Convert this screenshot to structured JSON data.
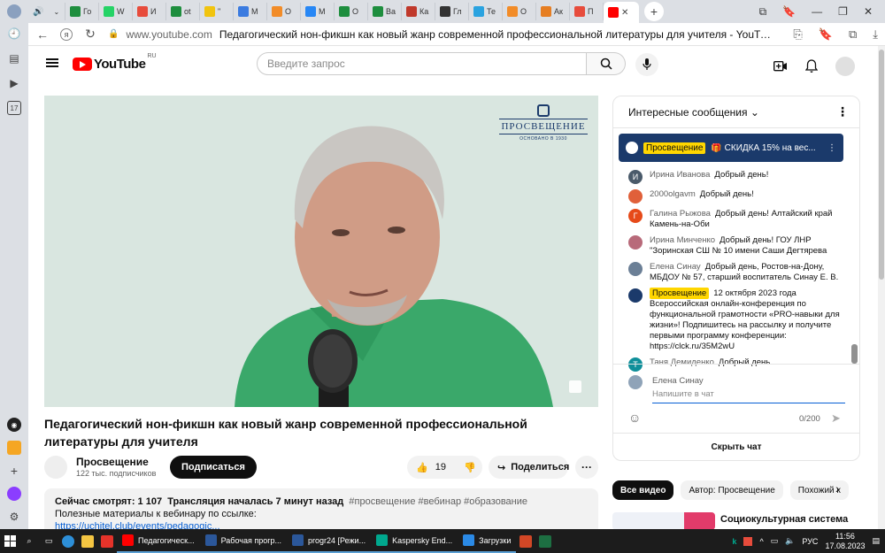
{
  "browser": {
    "tabs": [
      {
        "label": "Го",
        "color": "#1e8e3e"
      },
      {
        "label": "W",
        "color": "#25d366"
      },
      {
        "label": "И",
        "color": "#e74c3c"
      },
      {
        "label": "ot",
        "color": "#1e8e3e"
      },
      {
        "label": "\"",
        "color": "#f1c40f"
      },
      {
        "label": "М",
        "color": "#3b7be0"
      },
      {
        "label": "О",
        "color": "#f28c28"
      },
      {
        "label": "М",
        "color": "#2787f5"
      },
      {
        "label": "О",
        "color": "#1e8e3e"
      },
      {
        "label": "Ва",
        "color": "#1e8e3e"
      },
      {
        "label": "Ка",
        "color": "#c0392b"
      },
      {
        "label": "Гл",
        "color": "#333333"
      },
      {
        "label": "Те",
        "color": "#2aa3e0"
      },
      {
        "label": "О",
        "color": "#f28c28"
      },
      {
        "label": "Ак",
        "color": "#e67e22"
      },
      {
        "label": "П",
        "color": "#e74c3c"
      }
    ],
    "active_tab_color": "#ff0000",
    "new_tab_symbol": "+",
    "domain": "www.youtube.com",
    "page_title": "Педагогический нон-фикшн как новый жанр современной профессиональной литературы для учителя - YouTube",
    "rail_badge": "17"
  },
  "youtube": {
    "country": "RU",
    "logo_word": "YouTube",
    "search_placeholder": "Введите запрос",
    "brand": {
      "name": "ПРОСВЕЩЕНИЕ",
      "since": "ОСНОВАНО В 1930"
    },
    "video_title": "Педагогический нон-фикшн как новый жанр современной профессиональной литературы для учителя",
    "channel": {
      "name": "Просвещение",
      "subscribers": "122 тыс. подписчиков"
    },
    "subscribe_label": "Подписаться",
    "likes": "19",
    "share_label": "Поделиться",
    "description": {
      "watching": "Сейчас смотрят: 1 107",
      "started": "Трансляция началась 7 минут назад",
      "tags": "#просвещение #вебинар #образование",
      "line2": "Полезные материалы к вебинару по ссылке:",
      "link": "https://uchitel.club/events/pedagogic..."
    },
    "chat": {
      "header": "Интересные сообщения",
      "pinned": {
        "author": "Просвещение",
        "text": "🎁 СКИДКА 15% на вес..."
      },
      "messages": [
        {
          "author": "Ирина Иванова",
          "text": "Добрый день!",
          "avatar_letter": "И",
          "avatar_color": "#4a5a6a",
          "owner": false
        },
        {
          "author": "2000olgavm",
          "text": "Добрый день!",
          "avatar_letter": "",
          "avatar_color": "#e0603a",
          "owner": false
        },
        {
          "author": "Галина Рыжова",
          "text": "Добрый день! Алтайский край Камень-на-Оби",
          "avatar_letter": "Г",
          "avatar_color": "#e64a19",
          "owner": false
        },
        {
          "author": "Ирина Минченко",
          "text": "Добрый день! ГОУ ЛНР \"Зоринская СШ № 10 имени Саши Дегтярева",
          "avatar_letter": "",
          "avatar_color": "#b86a7a",
          "owner": false
        },
        {
          "author": "Елена Синау",
          "text": "Добрый день, Ростов-на-Дону, МБДОУ № 57, старший воспитатель Синау Е. В.",
          "avatar_letter": "",
          "avatar_color": "#6b7f96",
          "owner": false
        },
        {
          "author": "Просвещение",
          "text": "12 октября 2023 года Всероссийская онлайн-конференция по функциональной грамотности «PRO-навыки для жизни»! Подпишитесь на рассылку и получите первыми программу конференции: https://clck.ru/35M2wU",
          "avatar_letter": "",
          "avatar_color": "#1b3a6b",
          "owner": true
        },
        {
          "author": "Таня Демиденко",
          "text": "Добрый день.",
          "avatar_letter": "Т",
          "avatar_color": "#0f8f9a",
          "owner": false
        }
      ],
      "input_user": "Елена Синау",
      "input_placeholder": "Напишите в чат",
      "char_count": "0/200",
      "hide_label": "Скрыть чат"
    },
    "chips": [
      "Все видео",
      "Автор: Просвещение",
      "Похожий к"
    ],
    "recommendation_title": "Социокультурная система"
  },
  "taskbar": {
    "apps": [
      {
        "label": "Педагогическ...",
        "color": "#ff0000"
      },
      {
        "label": "Рабочая прогр...",
        "color": "#2b579a"
      },
      {
        "label": "progr24 [Режи...",
        "color": "#2b579a"
      },
      {
        "label": "Kaspersky End...",
        "color": "#00a88e"
      },
      {
        "label": "Загрузки",
        "color": "#2b8ae6"
      }
    ],
    "language": "РУС",
    "time": "11:56",
    "date": "17.08.2023"
  }
}
